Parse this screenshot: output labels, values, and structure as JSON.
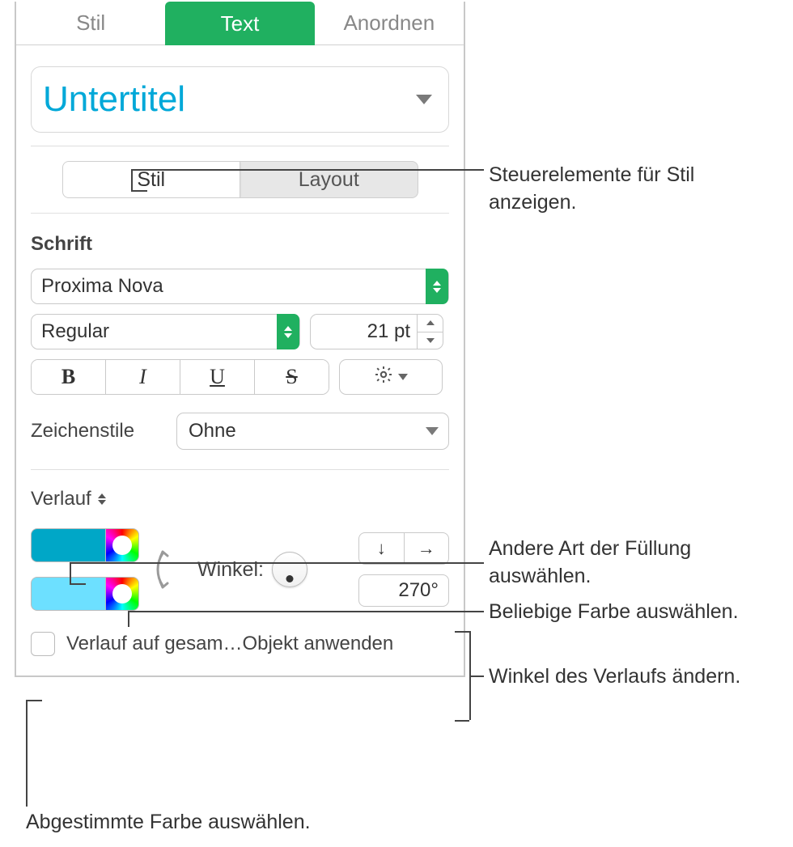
{
  "tabs": {
    "stil": "Stil",
    "text": "Text",
    "anordnen": "Anordnen"
  },
  "paragraphStyle": "Untertitel",
  "seg": {
    "stil": "Stil",
    "layout": "Layout"
  },
  "schrift": {
    "label": "Schrift",
    "font": "Proxima Nova",
    "weight": "Regular",
    "size": "21 pt"
  },
  "bius": {
    "b": "B",
    "i": "I",
    "u": "U",
    "s": "S"
  },
  "charStyles": {
    "label": "Zeichenstile",
    "value": "Ohne"
  },
  "fillType": "Verlauf",
  "angle": {
    "label": "Winkel:",
    "value": "270°",
    "down": "↓",
    "right": "→"
  },
  "applyWhole": "Verlauf auf gesam…Objekt anwenden",
  "callouts": {
    "c1": "Steuerelemente für Stil anzeigen.",
    "c2": "Andere Art der Füllung auswählen.",
    "c3": "Beliebige Farbe auswählen.",
    "c4": "Winkel des Verlaufs ändern.",
    "c5": "Abgestimmte Farbe auswählen."
  }
}
